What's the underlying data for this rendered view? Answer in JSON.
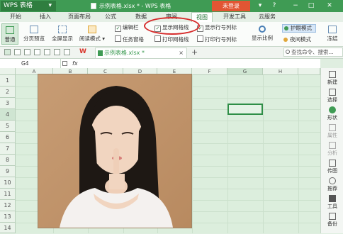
{
  "app": {
    "name": "WPS 表格",
    "menu_arrow": "▾"
  },
  "title": {
    "document": "示例表格.xlsx * - WPS 表格",
    "login": "未登录"
  },
  "window_controls": [
    "▾",
    "?",
    "−",
    "□",
    "✕"
  ],
  "menubar": {
    "items": [
      "开始",
      "插入",
      "页面布局",
      "公式",
      "数据",
      "审阅",
      "视图",
      "开发工具",
      "云服务"
    ],
    "active": "视图"
  },
  "ribbon": {
    "buttons": [
      "普通",
      "分页预览",
      "全屏显示",
      "阅读模式 ▾",
      "显示比例"
    ],
    "checkboxes": [
      {
        "label": "编辑栏",
        "checked": true
      },
      {
        "label": "显示网格线",
        "checked": true
      },
      {
        "label": "显示行号列标",
        "checked": true
      },
      {
        "label": "任务窗格",
        "checked": false
      },
      {
        "label": "打印网格线",
        "checked": false
      },
      {
        "label": "打印行号列标",
        "checked": false
      }
    ],
    "right_buttons": [
      "护眼模式",
      "夜间模式"
    ],
    "cut_label": "冻结"
  },
  "tabbar": {
    "doc_tab": "示例表格.xlsx *",
    "close": "×",
    "add": "+",
    "search_placeholder": "查找命令、搜索..."
  },
  "formula": {
    "namebox": "G4",
    "fx": "fx"
  },
  "columns": [
    "A",
    "B",
    "C",
    "D",
    "E",
    "F",
    "G",
    "H"
  ],
  "rows": [
    "1",
    "2",
    "3",
    "4",
    "5",
    "6",
    "7",
    "8",
    "9",
    "10",
    "11",
    "12",
    "13",
    "14",
    "15",
    "16"
  ],
  "selected_cell": "G4",
  "sidebar": {
    "items": [
      "新建",
      "选择",
      "形状",
      "属性",
      "分析",
      "传图",
      "推荐",
      "工具",
      "备份"
    ]
  },
  "colors": {
    "accent": "#3f9b54",
    "login": "#e25533",
    "grid": "#dceedd",
    "highlight": "#d62b2b"
  }
}
